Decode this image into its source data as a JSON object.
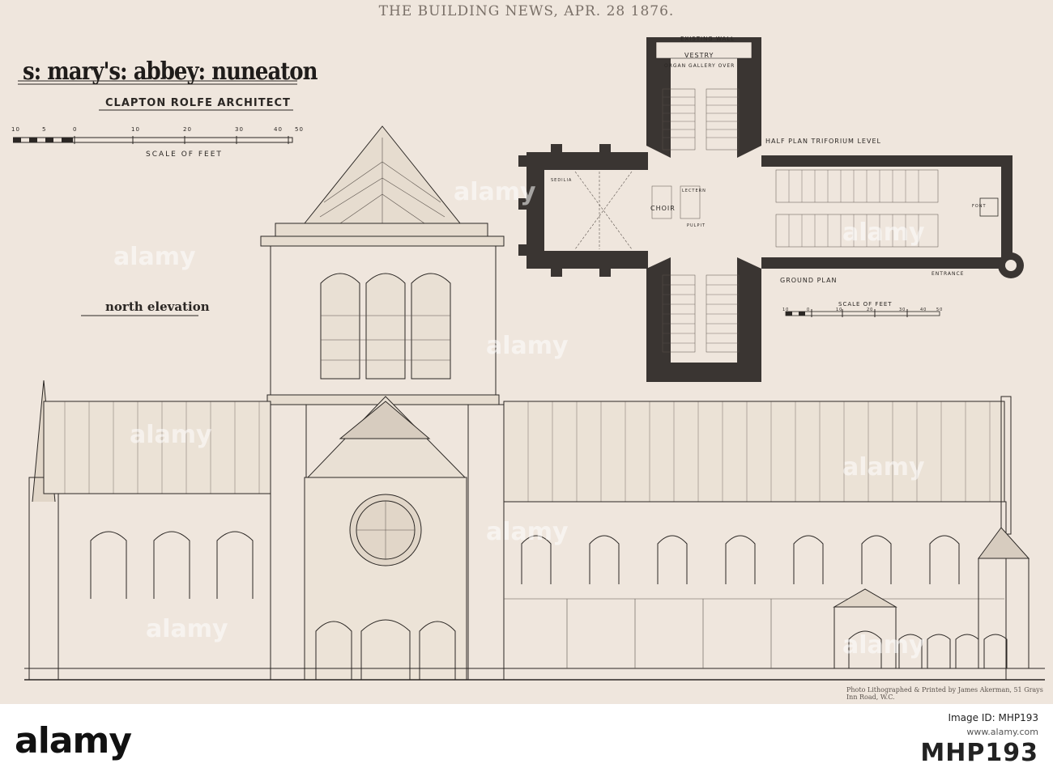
{
  "header": {
    "title": "THE BUILDING NEWS, APR. 28 1876."
  },
  "sheet": {
    "title": "s: mary's: abbey: nuneaton",
    "architect": "CLAPTON ROLFE ARCHITECT",
    "scale_label": "SCALE OF FEET",
    "scale_ticks": [
      "10",
      "5",
      "0",
      "10",
      "20",
      "30",
      "40",
      "50"
    ],
    "north_elevation_label": "north elevation",
    "plan": {
      "existing_wall": "EXISTING WALL",
      "vestry": "VESTRY",
      "organ_gallery": "ORGAN GALLERY OVER",
      "half_plan": "HALF PLAN TRIFORIUM LEVEL",
      "choir": "CHOIR",
      "lectern": "LECTERN",
      "pulpit": "PULPIT",
      "sedilia": "SEDILIA",
      "font": "FONT",
      "entrance": "ENTRANCE",
      "ground_plan": "GROUND PLAN",
      "scale_label": "SCALE OF FEET",
      "scale_ticks": [
        "10",
        "0",
        "10",
        "20",
        "30",
        "40",
        "50"
      ]
    },
    "credit": "Photo Lithographed & Printed by James Akerman, 51 Grays Inn Road, W.C."
  },
  "watermark": {
    "text": "alamy"
  },
  "footer": {
    "logo": "alamy",
    "image_id_label": "Image ID: MHP193",
    "url": "www.alamy.com",
    "image_id": "MHP193"
  },
  "colors": {
    "paper": "#efe6dd",
    "ink": "#2b2724",
    "wall": "#3a3532"
  }
}
